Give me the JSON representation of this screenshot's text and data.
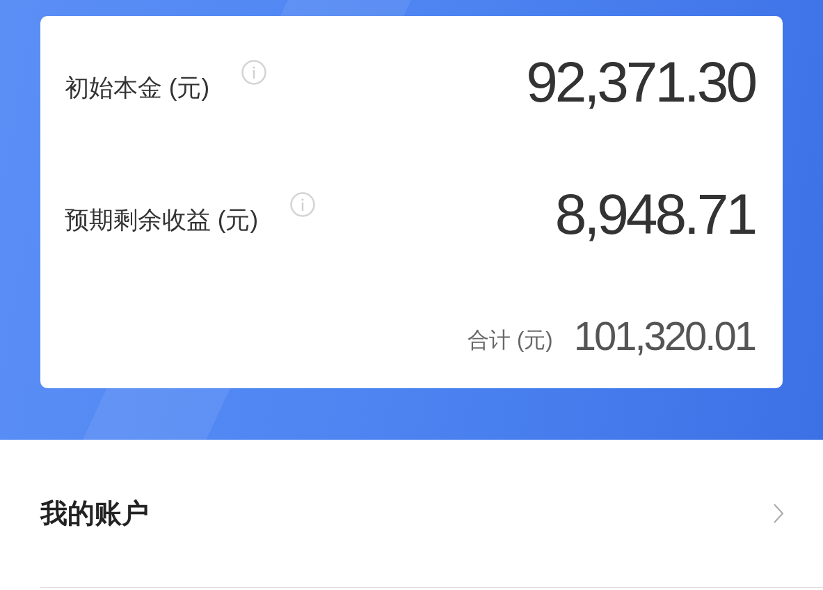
{
  "summary_card": {
    "items": [
      {
        "label": "初始本金 (元)",
        "value": "92,371.30"
      },
      {
        "label": "预期剩余收益 (元)",
        "value": "8,948.71"
      }
    ],
    "total": {
      "label": "合计 (元)",
      "value": "101,320.01"
    }
  },
  "menu": [
    {
      "label": "我的账户"
    }
  ]
}
